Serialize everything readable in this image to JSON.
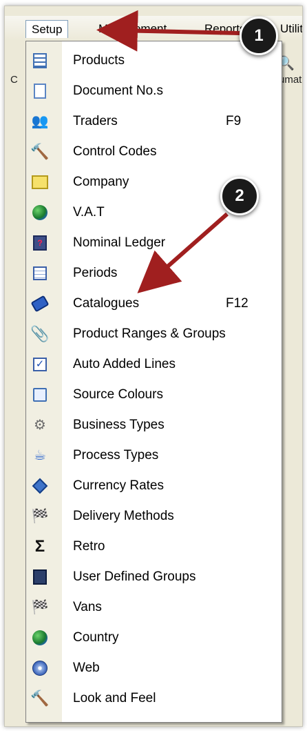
{
  "menubar": {
    "items": [
      "Setup",
      "Management",
      "Reports",
      "Utilities"
    ],
    "active_item": "Setup",
    "left_stub": "C",
    "right_stub": "umat"
  },
  "menu": {
    "items": [
      {
        "label": "Products",
        "shortcut": "",
        "icon": "products-icon"
      },
      {
        "label": "Document No.s",
        "shortcut": "",
        "icon": "document-icon"
      },
      {
        "label": "Traders",
        "shortcut": "F9",
        "icon": "people-icon"
      },
      {
        "label": "Control Codes",
        "shortcut": "",
        "icon": "hammer-icon"
      },
      {
        "label": "Company",
        "shortcut": "",
        "icon": "ruler-icon"
      },
      {
        "label": "V.A.T",
        "shortcut": "",
        "icon": "globe-icon"
      },
      {
        "label": "Nominal Ledger",
        "shortcut": "",
        "icon": "ledger-icon"
      },
      {
        "label": "Periods",
        "shortcut": "",
        "icon": "grid-icon"
      },
      {
        "label": "Catalogues",
        "shortcut": "F12",
        "icon": "book-icon"
      },
      {
        "label": "Product Ranges & Groups",
        "shortcut": "",
        "icon": "paperclip-icon"
      },
      {
        "label": "Auto Added Lines",
        "shortcut": "",
        "icon": "checkbox-icon"
      },
      {
        "label": "Source Colours",
        "shortcut": "",
        "icon": "palette-icon"
      },
      {
        "label": "Business Types",
        "shortcut": "",
        "icon": "gear-icon"
      },
      {
        "label": "Process Types",
        "shortcut": "",
        "icon": "mug-icon"
      },
      {
        "label": "Currency Rates",
        "shortcut": "",
        "icon": "diamond-icon"
      },
      {
        "label": "Delivery Methods",
        "shortcut": "",
        "icon": "flag-icon"
      },
      {
        "label": "Retro",
        "shortcut": "",
        "icon": "sigma-icon"
      },
      {
        "label": "User Defined Groups",
        "shortcut": "",
        "icon": "list-icon"
      },
      {
        "label": "Vans",
        "shortcut": "",
        "icon": "flag-icon"
      },
      {
        "label": "Country",
        "shortcut": "",
        "icon": "globe-icon"
      },
      {
        "label": "Web",
        "shortcut": "",
        "icon": "web-icon"
      },
      {
        "label": "Look and Feel",
        "shortcut": "",
        "icon": "hammer-icon"
      }
    ]
  },
  "annotations": [
    {
      "label": "1"
    },
    {
      "label": "2"
    }
  ],
  "colors": {
    "arrow": "#a01f1f",
    "menu_bg": "#ffffff",
    "gutter_bg": "#f1efe2",
    "menubar_bg": "#ece9d8"
  }
}
